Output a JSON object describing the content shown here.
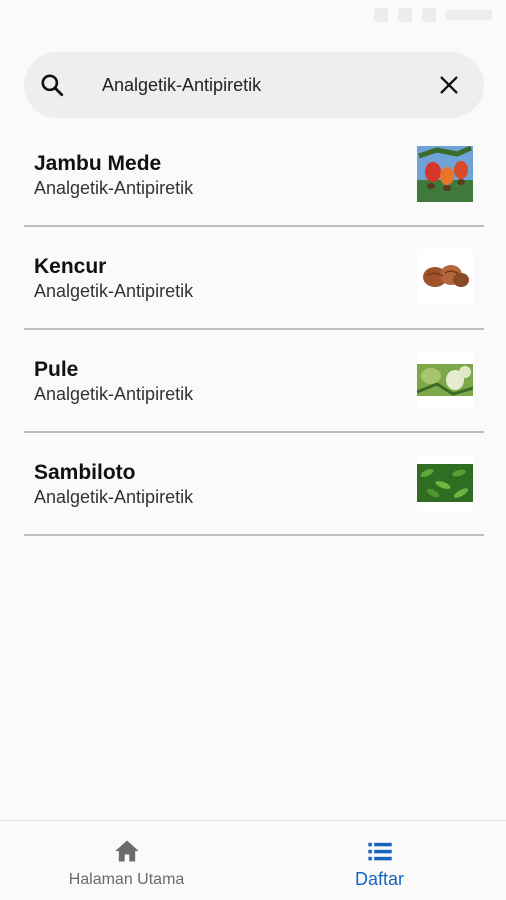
{
  "search": {
    "value": "Analgetik-Antipiretik",
    "search_icon": "search-icon",
    "clear_icon": "close-icon"
  },
  "items": [
    {
      "title": "Jambu Mede",
      "subtitle": "Analgetik-Antipiretik",
      "thumb": "cashew-fruit"
    },
    {
      "title": "Kencur",
      "subtitle": "Analgetik-Antipiretik",
      "thumb": "kencur-rhizome"
    },
    {
      "title": "Pule",
      "subtitle": "Analgetik-Antipiretik",
      "thumb": "pule-flowers"
    },
    {
      "title": "Sambiloto",
      "subtitle": "Analgetik-Antipiretik",
      "thumb": "sambiloto-leaves"
    }
  ],
  "nav": {
    "home_label": "Halaman Utama",
    "list_label": "Daftar",
    "home_icon": "home-icon",
    "list_icon": "list-icon"
  },
  "colors": {
    "accent": "#1565c0",
    "inactive": "#6b6b6b",
    "divider": "#bdbdbd"
  }
}
